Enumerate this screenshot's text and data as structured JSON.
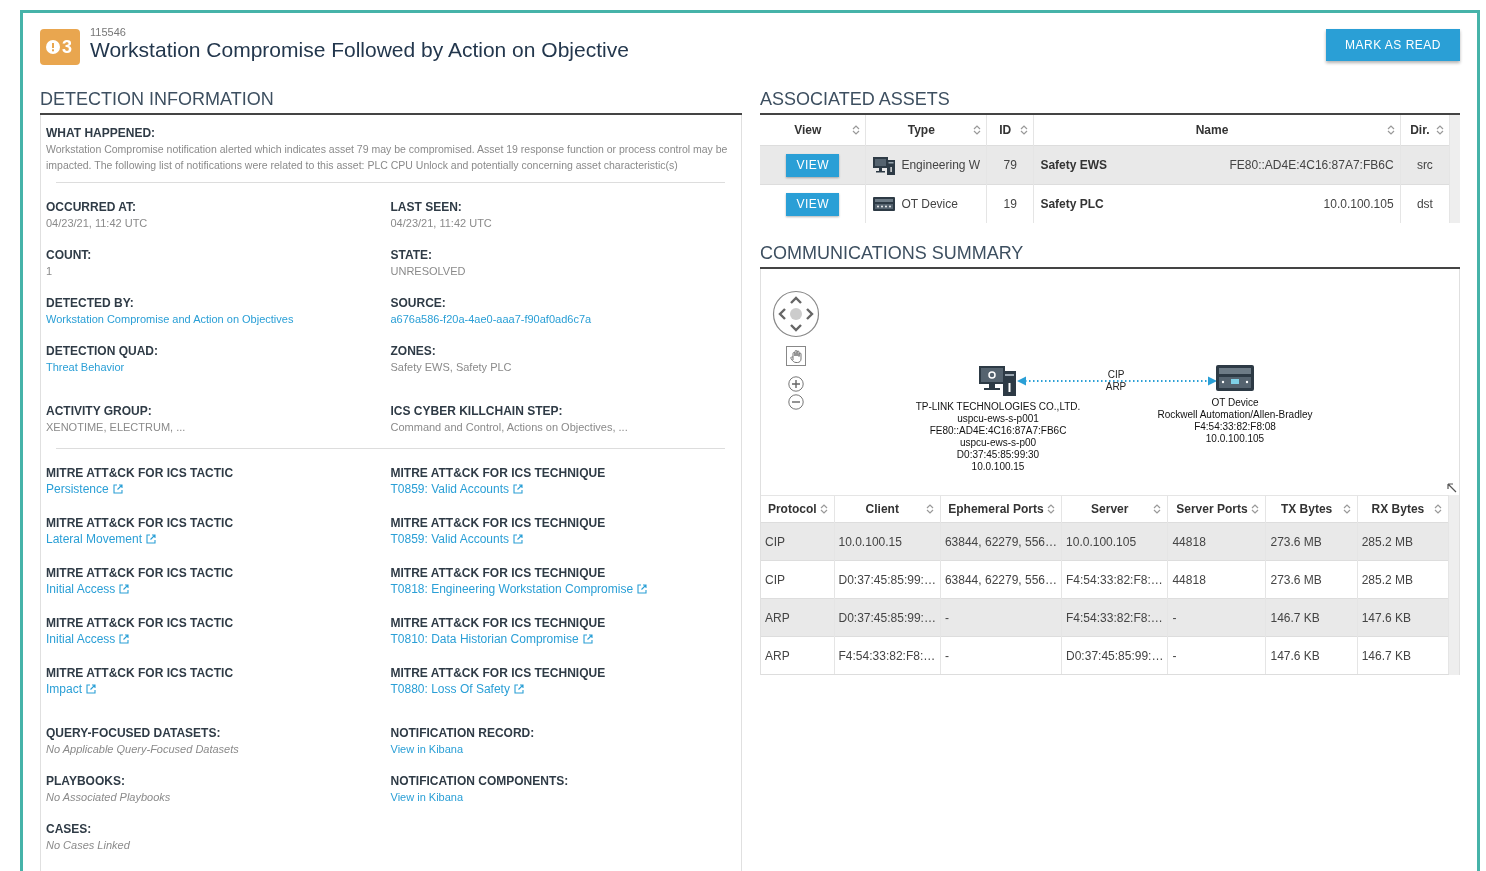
{
  "header": {
    "badge": "3",
    "record_id": "115546",
    "title": "Workstation Compromise Followed by Action on Objective",
    "button": "MARK AS READ"
  },
  "detection": {
    "heading": "DETECTION INFORMATION",
    "groups": [
      {
        "divider_after": true,
        "rows": [
          [
            {
              "label": "WHAT HAPPENED:",
              "value": "Workstation Compromise notification alerted which indicates asset 79 may be compromised. Asset 19 response function or process control may be impacted. The following list of notifications were related to this asset: PLC CPU Unlock and potentially concerning asset characteristic(s)",
              "kind": "text"
            }
          ]
        ]
      },
      {
        "divider_after": false,
        "rows": [
          [
            {
              "label": "OCCURRED AT:",
              "value": "04/23/21, 11:42 UTC",
              "kind": "text"
            },
            {
              "label": "LAST SEEN:",
              "value": "04/23/21, 11:42 UTC",
              "kind": "text"
            }
          ],
          [
            {
              "label": "COUNT:",
              "value": "1",
              "kind": "text"
            },
            {
              "label": "STATE:",
              "value": "UNRESOLVED",
              "kind": "text"
            }
          ],
          [
            {
              "label": "DETECTED BY:",
              "value": "Workstation Compromise and Action on Objectives",
              "kind": "link"
            },
            {
              "label": "SOURCE:",
              "value": "a676a586-f20a-4ae0-aaa7-f90af0ad6c7a",
              "kind": "link"
            }
          ],
          [
            {
              "label": "DETECTION QUAD:",
              "value": "Threat Behavior",
              "kind": "link"
            },
            {
              "label": "ZONES:",
              "value": "Safety EWS, Safety PLC",
              "kind": "text"
            }
          ]
        ]
      },
      {
        "divider_after": true,
        "rows": [
          [
            {
              "label": "ACTIVITY GROUP:",
              "value": "XENOTIME, ELECTRUM, ...",
              "kind": "text"
            },
            {
              "label": "ICS CYBER KILLCHAIN STEP:",
              "value": "Command and Control, Actions on Objectives, ...",
              "kind": "text"
            }
          ]
        ]
      },
      {
        "divider_after": false,
        "rows": [
          [
            {
              "label": "MITRE ATT&CK FOR ICS TACTIC",
              "value": "Persistence",
              "kind": "external"
            },
            {
              "label": "MITRE ATT&CK FOR ICS TECHNIQUE",
              "value": "T0859: Valid Accounts",
              "kind": "external"
            }
          ],
          [
            {
              "label": "MITRE ATT&CK FOR ICS TACTIC",
              "value": "Lateral Movement",
              "kind": "external"
            },
            {
              "label": "MITRE ATT&CK FOR ICS TECHNIQUE",
              "value": "T0859: Valid Accounts",
              "kind": "external"
            }
          ],
          [
            {
              "label": "MITRE ATT&CK FOR ICS TACTIC",
              "value": "Initial Access",
              "kind": "external"
            },
            {
              "label": "MITRE ATT&CK FOR ICS TECHNIQUE",
              "value": "T0818: Engineering Workstation Compromise",
              "kind": "external"
            }
          ],
          [
            {
              "label": "MITRE ATT&CK FOR ICS TACTIC",
              "value": "Initial Access",
              "kind": "external"
            },
            {
              "label": "MITRE ATT&CK FOR ICS TECHNIQUE",
              "value": "T0810: Data Historian Compromise",
              "kind": "external"
            }
          ],
          [
            {
              "label": "MITRE ATT&CK FOR ICS TACTIC",
              "value": "Impact",
              "kind": "external"
            },
            {
              "label": "MITRE ATT&CK FOR ICS TECHNIQUE",
              "value": "T0880: Loss Of Safety",
              "kind": "external"
            }
          ]
        ]
      },
      {
        "rows": [
          [
            {
              "label": "QUERY-FOCUSED DATASETS:",
              "value": "No Applicable Query-Focused Datasets",
              "kind": "italic"
            },
            {
              "label": "NOTIFICATION RECORD:",
              "value": "View in Kibana",
              "kind": "link"
            }
          ],
          [
            {
              "label": "PLAYBOOKS:",
              "value": "No Associated Playbooks",
              "kind": "italic"
            },
            {
              "label": "NOTIFICATION COMPONENTS:",
              "value": "View in Kibana",
              "kind": "link"
            }
          ],
          [
            {
              "label": "CASES:",
              "value": "No Cases Linked",
              "kind": "italic"
            }
          ]
        ]
      }
    ]
  },
  "assets": {
    "heading": "ASSOCIATED ASSETS",
    "columns": [
      "View",
      "Type",
      "ID",
      "Name",
      "Dir."
    ],
    "rows": [
      {
        "selected": true,
        "button": "VIEW",
        "kind": "workstation",
        "type": "Engineering W",
        "id": "79",
        "name": "Safety EWS",
        "address": "FE80::AD4E:4C16:87A7:FB6C",
        "dir": "src"
      },
      {
        "selected": false,
        "button": "VIEW",
        "kind": "plc",
        "type": "OT Device",
        "id": "19",
        "name": "Safety PLC",
        "address": "10.0.100.105",
        "dir": "dst"
      }
    ]
  },
  "communications": {
    "heading": "COMMUNICATIONS SUMMARY",
    "diagram": {
      "nodes": [
        {
          "kind": "workstation",
          "lines": [
            "TP-LINK TECHNOLOGIES CO.,LTD.",
            "uspcu-ews-s-p001",
            "FE80::AD4E:4C16:87A7:FB6C",
            "uspcu-ews-s-p00",
            "D0:37:45:85:99:30",
            "10.0.100.15"
          ]
        },
        {
          "kind": "plc",
          "lines": [
            "OT Device",
            "Rockwell Automation/Allen-Bradley",
            "F4:54:33:82:F8:08",
            "10.0.100.105"
          ]
        }
      ],
      "edge_labels": [
        "CIP",
        "ARP"
      ]
    },
    "columns": [
      "Protocol",
      "Client",
      "Ephemeral Ports",
      "Server",
      "Server Ports",
      "TX Bytes",
      "RX Bytes"
    ],
    "rows": [
      [
        "CIP",
        "10.0.100.15",
        "63844, 62279, 556…",
        "10.0.100.105",
        "44818",
        "273.6 MB",
        "285.2 MB"
      ],
      [
        "CIP",
        "D0:37:45:85:99:…",
        "63844, 62279, 556…",
        "F4:54:33:82:F8:…",
        "44818",
        "273.6 MB",
        "285.2 MB"
      ],
      [
        "ARP",
        "D0:37:45:85:99:…",
        "-",
        "F4:54:33:82:F8:…",
        "-",
        "146.7 KB",
        "147.6 KB"
      ],
      [
        "ARP",
        "F4:54:33:82:F8:…",
        "-",
        "D0:37:45:85:99:…",
        "-",
        "147.6 KB",
        "146.7 KB"
      ]
    ]
  }
}
